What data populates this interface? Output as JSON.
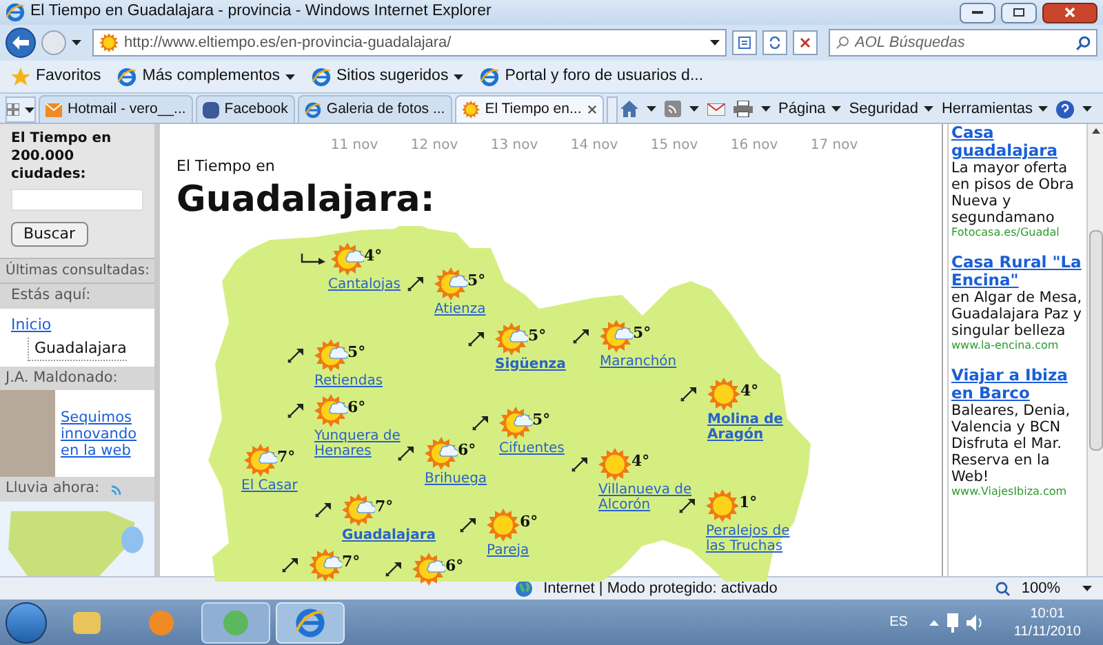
{
  "window": {
    "title": "El Tiempo en Guadalajara - provincia - Windows Internet Explorer"
  },
  "address_bar": {
    "url": "http://www.eltiempo.es/en-provincia-guadalajara/"
  },
  "search": {
    "placeholder": "AOL Búsquedas"
  },
  "favorites_bar": [
    {
      "label": "Favoritos",
      "kind": "star"
    },
    {
      "label": "Más complementos",
      "kind": "menu"
    },
    {
      "label": "Sitios sugeridos",
      "kind": "menu"
    },
    {
      "label": "Portal y foro de usuarios d...",
      "kind": "page"
    }
  ],
  "tabs": [
    {
      "label": "Hotmail - vero__...",
      "selected": false,
      "kind": "mail"
    },
    {
      "label": "Facebook",
      "selected": false,
      "kind": "facebook"
    },
    {
      "label": "Galeria de fotos ...",
      "selected": false,
      "kind": "ie"
    },
    {
      "label": "El Tiempo en...",
      "selected": true,
      "kind": "sun"
    }
  ],
  "command_bar": [
    "Página",
    "Seguridad",
    "Herramientas"
  ],
  "sidebar": {
    "search_title": "El Tiempo en 200.000 ciudades:",
    "button": "Buscar",
    "recent_title": "Últimas consultadas:",
    "breadcrumb_title": "Estás aquí:",
    "breadcrumb": [
      "Inicio",
      "Guadalajara"
    ],
    "author_title": "J.A. Maldonado:",
    "author_link": "Sequimos innovando en la web",
    "rain_title": "Lluvia ahora:"
  },
  "dates": [
    "11 nov",
    "12 nov",
    "13 nov",
    "14 nov",
    "15 nov",
    "16 nov",
    "17 nov"
  ],
  "heading_small": "El Tiempo en",
  "heading": "Guadalajara:",
  "towns": [
    {
      "name": "Cantalojas",
      "temp": "4°",
      "kind": "partly_cloudy",
      "wind": {
        "kind": "east"
      },
      "bold": false
    },
    {
      "name": "Atienza",
      "temp": "5°",
      "kind": "partly_cloudy",
      "wind": {
        "kind": "northeast"
      },
      "bold": false
    },
    {
      "name": "Retiendas",
      "temp": "5°",
      "kind": "partly_cloudy",
      "wind": {
        "kind": "northeast"
      },
      "bold": false
    },
    {
      "name": "Sigüenza",
      "temp": "5°",
      "kind": "partly_cloudy",
      "wind": {
        "kind": "northeast"
      },
      "bold": true
    },
    {
      "name": "Maranchón",
      "temp": "5°",
      "kind": "partly_cloudy",
      "wind": {
        "kind": "northeast"
      },
      "bold": false
    },
    {
      "name": "Yunquera de Henares",
      "temp": "6°",
      "kind": "partly_cloudy",
      "wind": {
        "kind": "northeast"
      },
      "bold": false
    },
    {
      "name": "Cifuentes",
      "temp": "5°",
      "kind": "partly_cloudy",
      "wind": {
        "kind": "northeast"
      },
      "bold": false
    },
    {
      "name": "Molina de Aragón",
      "temp": "4°",
      "kind": "sunny",
      "wind": {
        "kind": "northeast"
      },
      "bold": true
    },
    {
      "name": "El Casar",
      "temp": "7°",
      "kind": "partly_cloudy",
      "bold": false
    },
    {
      "name": "Brihuega",
      "temp": "6°",
      "kind": "partly_cloudy",
      "wind": {
        "kind": "northeast"
      },
      "bold": false
    },
    {
      "name": "Villanueva de Alcorón",
      "temp": "4°",
      "kind": "sunny",
      "wind": {
        "kind": "northeast"
      },
      "bold": false
    },
    {
      "name": "Guadalajara",
      "temp": "7°",
      "kind": "partly_cloudy",
      "wind": {
        "kind": "northeast"
      },
      "bold": true
    },
    {
      "name": "Pareja",
      "temp": "6°",
      "kind": "sunny",
      "wind": {
        "kind": "northeast"
      },
      "bold": false
    },
    {
      "name": "Peralejos de las Truchas",
      "temp": "1°",
      "kind": "sunny",
      "wind": {
        "kind": "northeast"
      },
      "bold": false
    },
    {
      "temp": "7°",
      "kind": "partly_cloudy",
      "wind": {
        "kind": "northeast"
      }
    },
    {
      "temp": "6°",
      "kind": "partly_cloudy",
      "wind": {
        "kind": "northeast"
      }
    }
  ],
  "ads": [
    {
      "title": "Casa guadalajara",
      "body": "La mayor oferta en pisos de Obra Nueva y segundamano",
      "url": "Fotocasa.es/Guadal"
    },
    {
      "title": "Casa Rural \"La Encina\"",
      "body": "en Algar de Mesa, Guadalajara Paz y singular belleza",
      "url": "www.la-encina.com"
    },
    {
      "title": "Viajar a Ibiza en Barco",
      "body": "Baleares, Denia, Valencia y BCN Disfruta el Mar. Reserva en la Web!",
      "url": "www.ViajesIbiza.com"
    }
  ],
  "status_bar": {
    "zone": "Internet | Modo protegido: activado",
    "zoom": "100%"
  },
  "taskbar": {
    "language": "ES",
    "time": "10:01",
    "date": "11/11/2010"
  }
}
